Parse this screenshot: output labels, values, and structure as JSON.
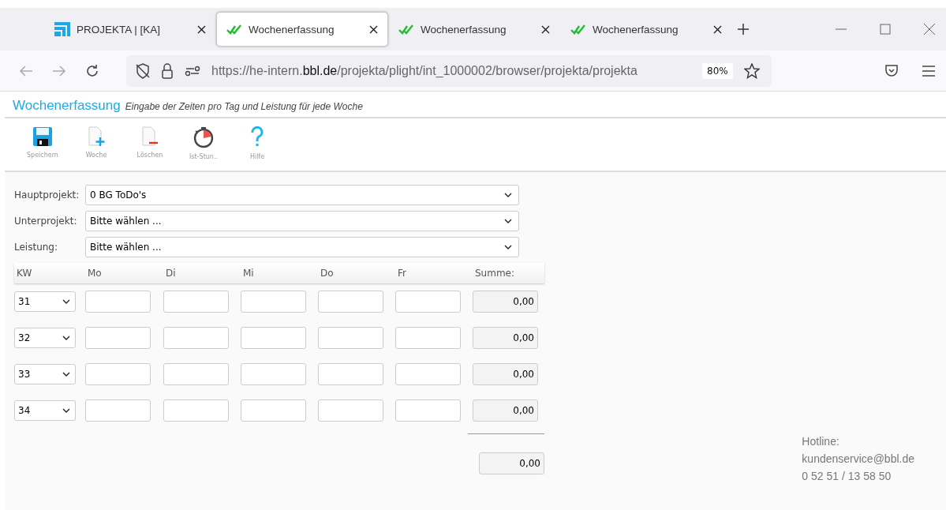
{
  "browser": {
    "tabs": [
      {
        "title": "PROJEKTA | [KA]",
        "selected": false
      },
      {
        "title": "Wochenerfassung",
        "selected": true
      },
      {
        "title": "Wochenerfassung",
        "selected": false
      },
      {
        "title": "Wochenerfassung",
        "selected": false
      }
    ],
    "url": {
      "prefix": "https://he-intern.",
      "host": "bbl.de",
      "path": "/projekta/plight/int_1000002/browser/projekta/projekta"
    },
    "zoom": "80%"
  },
  "page": {
    "title": "Wochenerfassung",
    "subtitle": "Eingabe der Zeiten pro Tag und Leistung für jede Woche",
    "toolbar": [
      {
        "kind": "save",
        "label": "Speichern"
      },
      {
        "kind": "add",
        "label": "Woche"
      },
      {
        "kind": "delete",
        "label": "Löschen"
      },
      {
        "kind": "timer",
        "label": "Ist-Stun.."
      },
      {
        "kind": "help",
        "label": "Hilfe"
      }
    ],
    "selects": [
      {
        "label": "Hauptprojekt:",
        "value": "0 BG ToDo's"
      },
      {
        "label": "Unterprojekt:",
        "value": "Bitte wählen ..."
      },
      {
        "label": "Leistung:",
        "value": "Bitte wählen ..."
      }
    ],
    "table": {
      "columns": [
        "KW",
        "Mo",
        "Di",
        "Mi",
        "Do",
        "Fr",
        "Summe:"
      ],
      "rows": [
        {
          "week": "31",
          "sum": "0,00"
        },
        {
          "week": "32",
          "sum": "0,00"
        },
        {
          "week": "33",
          "sum": "0,00"
        },
        {
          "week": "34",
          "sum": "0,00"
        }
      ],
      "total": "0,00"
    },
    "hotline": [
      "Hotline:",
      "kundenservice@bbl.de",
      "0 52 51 / 13 58 50"
    ]
  }
}
